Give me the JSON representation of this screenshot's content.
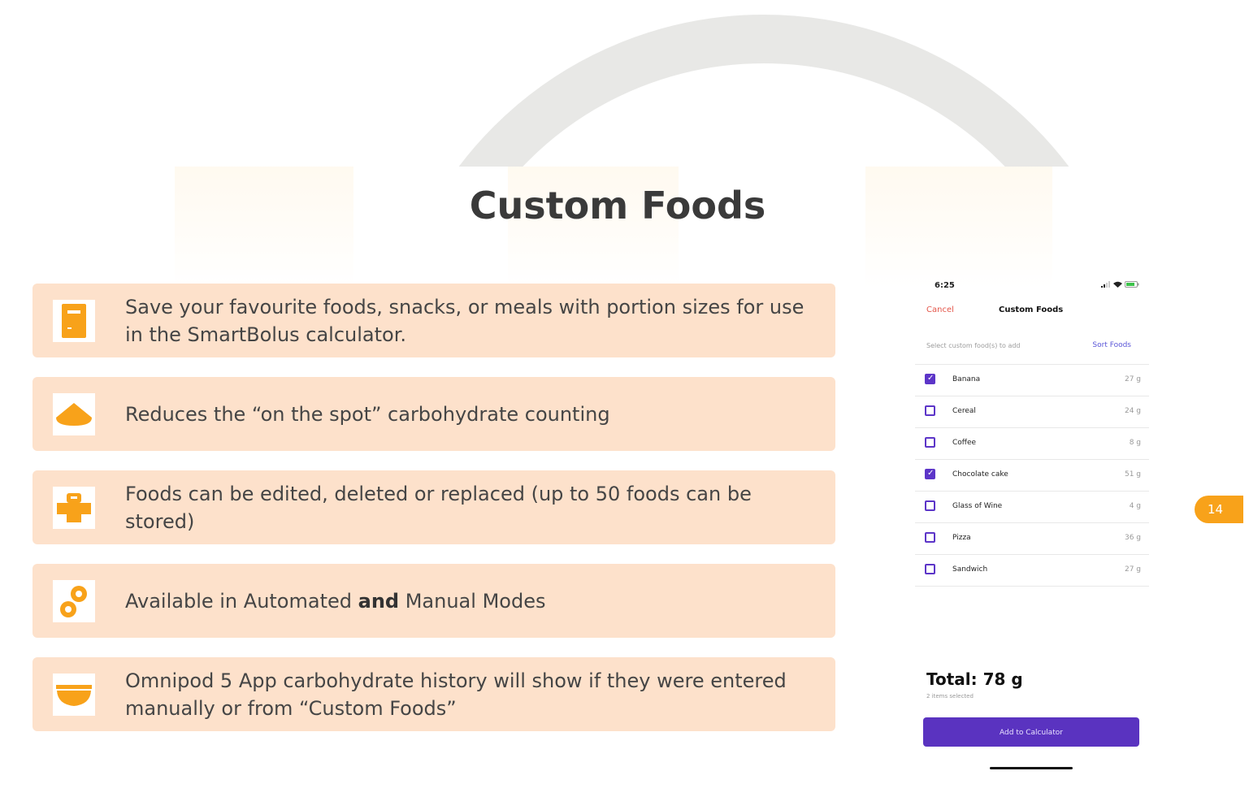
{
  "slide": {
    "title": "Custom Foods",
    "page_number": "14",
    "accent_color": "#f8a21a",
    "row_color": "#fde1cb"
  },
  "rows": [
    {
      "icon": "calculator-icon",
      "text": "Save your favourite foods, snacks, or meals with portion sizes for use  in the SmartBolus calculator."
    },
    {
      "icon": "watermelon-slice-icon",
      "text": "Reduces the “on the spot” carbohydrate counting"
    },
    {
      "icon": "sandwich-icon",
      "text": "Foods can be edited, deleted or replaced (up to 50 foods can be stored)"
    },
    {
      "icon": "gears-icon",
      "text_before": "Available in Automated ",
      "text_bold": "and",
      "text_after": " Manual Modes"
    },
    {
      "icon": "bowl-icon",
      "text": "Omnipod 5 App carbohydrate history will show if they were entered manually or from “Custom Foods”"
    }
  ],
  "phone": {
    "time": "6:25",
    "cancel": "Cancel",
    "title": "Custom Foods",
    "subtitle": "Select custom food(s) to add",
    "sort": "Sort Foods",
    "items": [
      {
        "name": "Banana",
        "value": "27 g",
        "checked": true
      },
      {
        "name": "Cereal",
        "value": "24 g",
        "checked": false
      },
      {
        "name": "Coffee",
        "value": "8 g",
        "checked": false
      },
      {
        "name": "Chocolate cake",
        "value": "51 g",
        "checked": true
      },
      {
        "name": "Glass of Wine",
        "value": "4 g",
        "checked": false
      },
      {
        "name": "Pizza",
        "value": "36 g",
        "checked": false
      },
      {
        "name": "Sandwich",
        "value": "27 g",
        "checked": false
      }
    ],
    "total": "Total: 78 g",
    "selected_count": "2 items selected",
    "add_button": "Add to Calculator",
    "primary_color": "#5a33c0",
    "cancel_color": "#e4574b"
  }
}
